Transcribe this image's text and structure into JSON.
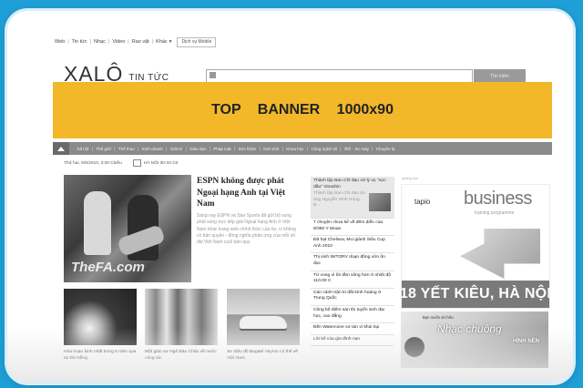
{
  "topnav": {
    "links": [
      "Web",
      "Tin tức",
      "Nhạc",
      "Video",
      "Rao vặt",
      "Khác"
    ],
    "more_arrow": "▾",
    "mobile_label": "Dịch vụ Mobile"
  },
  "logo": {
    "brand": "XALỘ",
    "section": "TIN TỨC"
  },
  "search": {
    "button_label": "Tìm kiếm"
  },
  "banner": {
    "text": "TOP BANNER 1000x90"
  },
  "category_nav": [
    "Xã hội",
    "Thế giới",
    "Thể thao",
    "Kinh doanh",
    "Giải trí",
    "Giáo dục",
    "Pháp luật",
    "Sức khỏe",
    "Giới tính",
    "Khoa học",
    "Công nghệ số",
    "Ôtô - Xe máy",
    "Chuyện lạ"
  ],
  "dateline": {
    "date": "Thứ hai, 5/6/2010, 3:30 Chiều",
    "weather": "HÀ NỘI 30-34 C0"
  },
  "featured": {
    "title": "ESPN không được phát Ngoại hạng Anh tại Việt Nam",
    "summary": "Sáng nay ESPN và Star Sports đã gửi bổ sung phát sóng trực tiếp giải Ngoại hạng Anh ở Việt Nam khác trang web chính thức của họ, vì không có bản quyền - đồng nghĩa phản ứng của mỗi số đài Việt Nam cuối bản quy.",
    "watermark": "TheFA.com"
  },
  "thumbs": [
    {
      "caption": "Hóa hoạn kinh nhất trong 5 năm qua tại Đà Nẵng"
    },
    {
      "caption": "Một giáo sư Ngô Bảo Châu về nước công tác"
    },
    {
      "caption": "Xe triệu đô Bugatti Veyron có thể về Việt Nam"
    }
  ],
  "news_list": {
    "first": {
      "title": "Thành lập Ban Chỉ đạo xử lý vụ \"xực dầu\" Vinashin",
      "subtitle": "Thành lập Ban Chỉ đạo do ông Nguyễn Sinh Hùng, Đ..."
    },
    "items": [
      "7 chuyện chưa kể về đêm diễn của 9/360 Y Moan",
      "Đã hạt Chelsea, MU giành Siêu Cup Anh 2010",
      "Thị sinh tWTORV doạn đông vớn ôn đục",
      "Từ vong vì lời tắm sông hơn ở nhiệt độ 110.00 C",
      "Cán cảnh trận kì đất kính hoàng ở Trung Quốc",
      "Công bố điểm sàn thi tuyển sinh đại học, cao đẳng",
      "Đến Watercone sơ tán vì khủi bụi",
      "Lời kể của gia đình nạn"
    ]
  },
  "ads": {
    "label": "quảng cáo",
    "ad1": {
      "logo": "tapio",
      "headline": "business",
      "tagline": "training programme",
      "address": "18 YẾT KIÊU, HÀ NỘI"
    },
    "ad2": {
      "small": "Bạn muốn sở hữu",
      "title": "Nhạc chuông",
      "subtitle": "HÌNH NỀN"
    }
  },
  "colors": {
    "background": "#1e9fd6",
    "banner": "#f2b829",
    "nav": "#8a8a8a"
  },
  "icons": [
    "home-icon",
    "search-icon",
    "weather-icon"
  ]
}
